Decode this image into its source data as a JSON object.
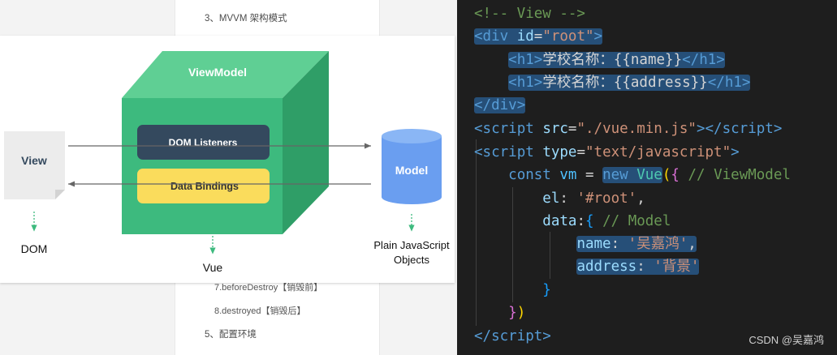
{
  "toc": {
    "item_top": "3、MVVM 架构模式",
    "item_before_destroy": "7.beforeDestroy【销毁前】",
    "item_destroyed": "8.destroyed【销毁后】",
    "item_env": "5、配置环境"
  },
  "diagram": {
    "viewmodel_label": "ViewModel",
    "dom_listeners_label": "DOM Listeners",
    "data_bindings_label": "Data Bindings",
    "view_label": "View",
    "model_label": "Model",
    "dom_caption": "DOM",
    "vue_caption": "Vue",
    "plain_js_caption_line1": "Plain JavaScript",
    "plain_js_caption_line2": "Objects",
    "colors": {
      "cube_front": "#3dba7e",
      "cube_top": "#5fcf94",
      "cube_side": "#2f9e67",
      "listeners_box": "#34495e",
      "bindings_box": "#fadc5c",
      "model_cylinder": "#6a9ef0",
      "view_doc": "#ececec"
    }
  },
  "code": {
    "comment_view": "<!-- View -->",
    "div_open_tag": "div",
    "id_attr": "id",
    "id_value": "\"root\"",
    "h1_tag": "h1",
    "line_name_text": "学校名称：{{name}}",
    "line_address_text": "学校名称：{{address}}",
    "script_tag": "script",
    "src_attr": "src",
    "src_value": "\"./vue.min.js\"",
    "type_attr": "type",
    "type_value": "\"text/javascript\"",
    "const_kw": "const",
    "vm_var": "vm",
    "new_kw": "new",
    "vue_class": "Vue",
    "comment_viewmodel": "// ViewModel",
    "el_key": "el",
    "el_value": "'#root'",
    "data_key": "data",
    "comment_model": "// Model",
    "name_key": "name",
    "name_value": "'吴嘉鸿'",
    "address_key": "address",
    "address_value": "'背景'"
  },
  "watermark": "CSDN @吴嘉鸿"
}
